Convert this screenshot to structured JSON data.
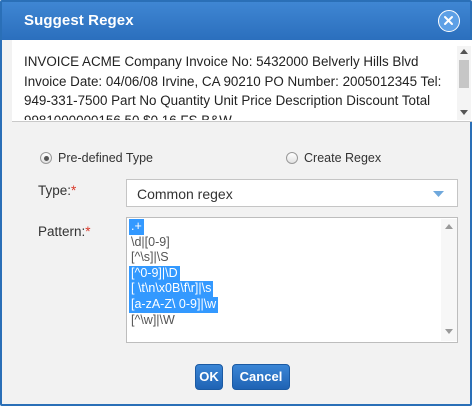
{
  "dialog": {
    "title": "Suggest Regex",
    "close_icon": "close-circle-icon"
  },
  "sample": {
    "text": "INVOICE ACME Company Invoice No: 5432000 Belverly Hills Blvd Invoice Date: 04/06/08 Irvine, CA 90210 PO Number: 2005012345 Tel: 949-331-7500 Part No Quantity Unit Price Description Discount Total 9981000000156 50 $0.16 FS B&W"
  },
  "mode": {
    "options": [
      {
        "label": "Pre-defined Type",
        "checked": true
      },
      {
        "label": "Create Regex",
        "checked": false
      }
    ]
  },
  "type_field": {
    "label": "Type:",
    "required_mark": "*",
    "value": "Common regex"
  },
  "pattern_field": {
    "label": "Pattern:",
    "required_mark": "*",
    "items": [
      {
        "text": ".+",
        "selected": true
      },
      {
        "text": "\\d|[0-9]",
        "selected": false
      },
      {
        "text": "[^\\s]|\\S",
        "selected": false
      },
      {
        "text": "[^0-9]|\\D",
        "selected": true
      },
      {
        "text": "[ \\t\\n\\x0B\\f\\r]|\\s",
        "selected": true
      },
      {
        "text": "[a-zA-Z\\ 0-9]|\\w",
        "selected": true
      },
      {
        "text": "[^\\w]|\\W",
        "selected": false
      }
    ]
  },
  "actions": {
    "ok_label": "OK",
    "cancel_label": "Cancel"
  },
  "colors": {
    "titlebar": "#2b6fbd",
    "selection": "#3399ff",
    "required": "#d9392a"
  }
}
